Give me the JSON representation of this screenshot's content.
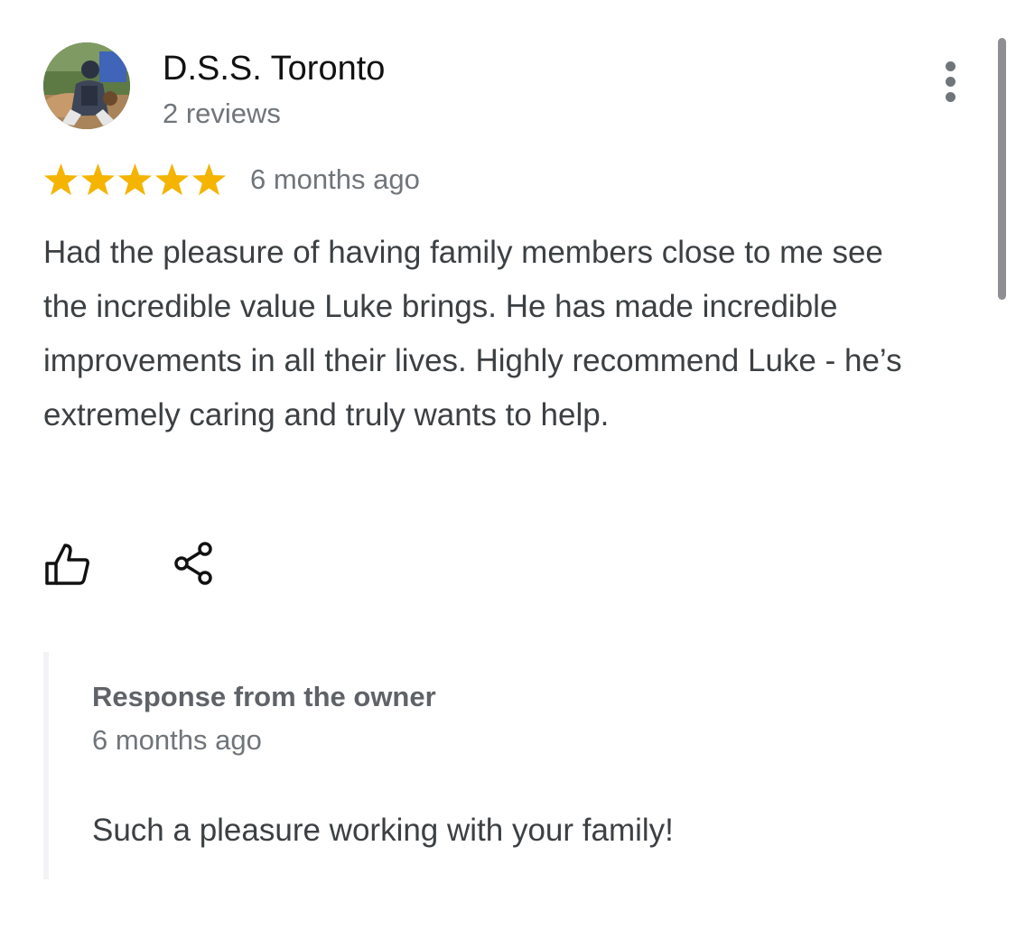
{
  "review": {
    "author": {
      "name": "D.S.S. Toronto",
      "reviews": "2 reviews",
      "avatar": "baseball-catcher-photo"
    },
    "rating": 5,
    "rating_max": 5,
    "star_color": "#f4b400",
    "date": "6 months ago",
    "text": "Had the pleasure of having family members close to me see the incredible value Luke brings. He has made incredible improvements in all their lives. Highly recommend Luke - he’s extremely caring and truly wants to help.",
    "actions": {
      "like_icon": "thumbs-up-icon",
      "share_icon": "share-icon",
      "more_icon": "more-vertical-icon"
    }
  },
  "owner_response": {
    "title": "Response from the owner",
    "date": "6 months ago",
    "text": "Such a pleasure working with your family!"
  }
}
